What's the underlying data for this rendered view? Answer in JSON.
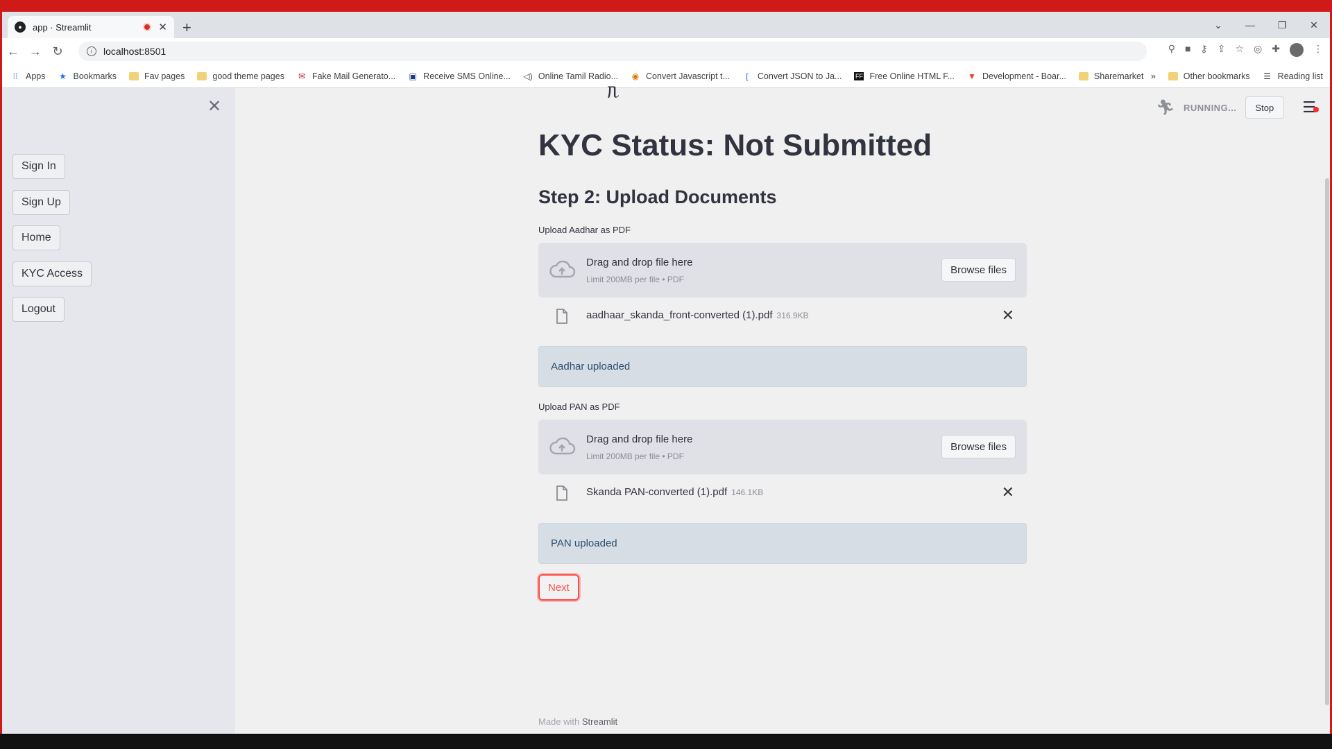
{
  "browser": {
    "tab_title": "app · Streamlit",
    "tab_close": "✕",
    "new_tab": "+",
    "window_controls": [
      "⌄",
      "—",
      "❐",
      "✕"
    ],
    "url": "localhost:8501",
    "bookmarks": [
      {
        "label": "Apps",
        "icon": "apps-grid-icon"
      },
      {
        "label": "Bookmarks",
        "icon": "star-icon"
      },
      {
        "label": "Fav pages",
        "icon": "folder-icon"
      },
      {
        "label": "good theme pages",
        "icon": "folder-icon"
      },
      {
        "label": "Fake Mail Generato...",
        "icon": "mail-icon"
      },
      {
        "label": "Receive SMS Online...",
        "icon": "sms-icon"
      },
      {
        "label": "Online Tamil Radio...",
        "icon": "radio-icon"
      },
      {
        "label": "Convert Javascript t...",
        "icon": "convert-icon"
      },
      {
        "label": "Convert JSON to Ja...",
        "icon": "json-icon"
      },
      {
        "label": "Free Online HTML F...",
        "icon": "html-icon"
      },
      {
        "label": "Development - Boar...",
        "icon": "gitlab-icon"
      },
      {
        "label": "Sharemarket",
        "icon": "folder-icon"
      }
    ],
    "overflow": "»",
    "other_bookmarks": "Other bookmarks",
    "reading_list": "Reading list"
  },
  "sidebar": {
    "close": "✕",
    "buttons": [
      "Sign In",
      "Sign Up",
      "Home",
      "KYC Access",
      "Logout"
    ]
  },
  "header": {
    "status": "RUNNING...",
    "stop": "Stop",
    "menu": "☰"
  },
  "main": {
    "partial_text": "ᥰ",
    "title": "KYC Status: Not Submitted",
    "subtitle": "Step 2: Upload Documents",
    "aadhar": {
      "label": "Upload Aadhar as PDF",
      "drop_title": "Drag and drop file here",
      "drop_sub": "Limit 200MB per file • PDF",
      "browse": "Browse files",
      "file_name": "aadhaar_skanda_front-converted (1).pdf",
      "file_size": "316.9KB",
      "remove": "✕",
      "message": "Aadhar uploaded"
    },
    "pan": {
      "label": "Upload PAN as PDF",
      "drop_title": "Drag and drop file here",
      "drop_sub": "Limit 200MB per file • PDF",
      "browse": "Browse files",
      "file_name": "Skanda PAN-converted (1).pdf",
      "file_size": "146.1KB",
      "remove": "✕",
      "message": "PAN uploaded"
    },
    "next": "Next"
  },
  "footer": {
    "prefix": "Made with ",
    "brand": "Streamlit"
  },
  "colors": {
    "accent": "#ff4b4b",
    "info_bg": "#d6dde5",
    "info_text": "#2d4f71",
    "sidebar_bg": "#e6e7ec"
  }
}
